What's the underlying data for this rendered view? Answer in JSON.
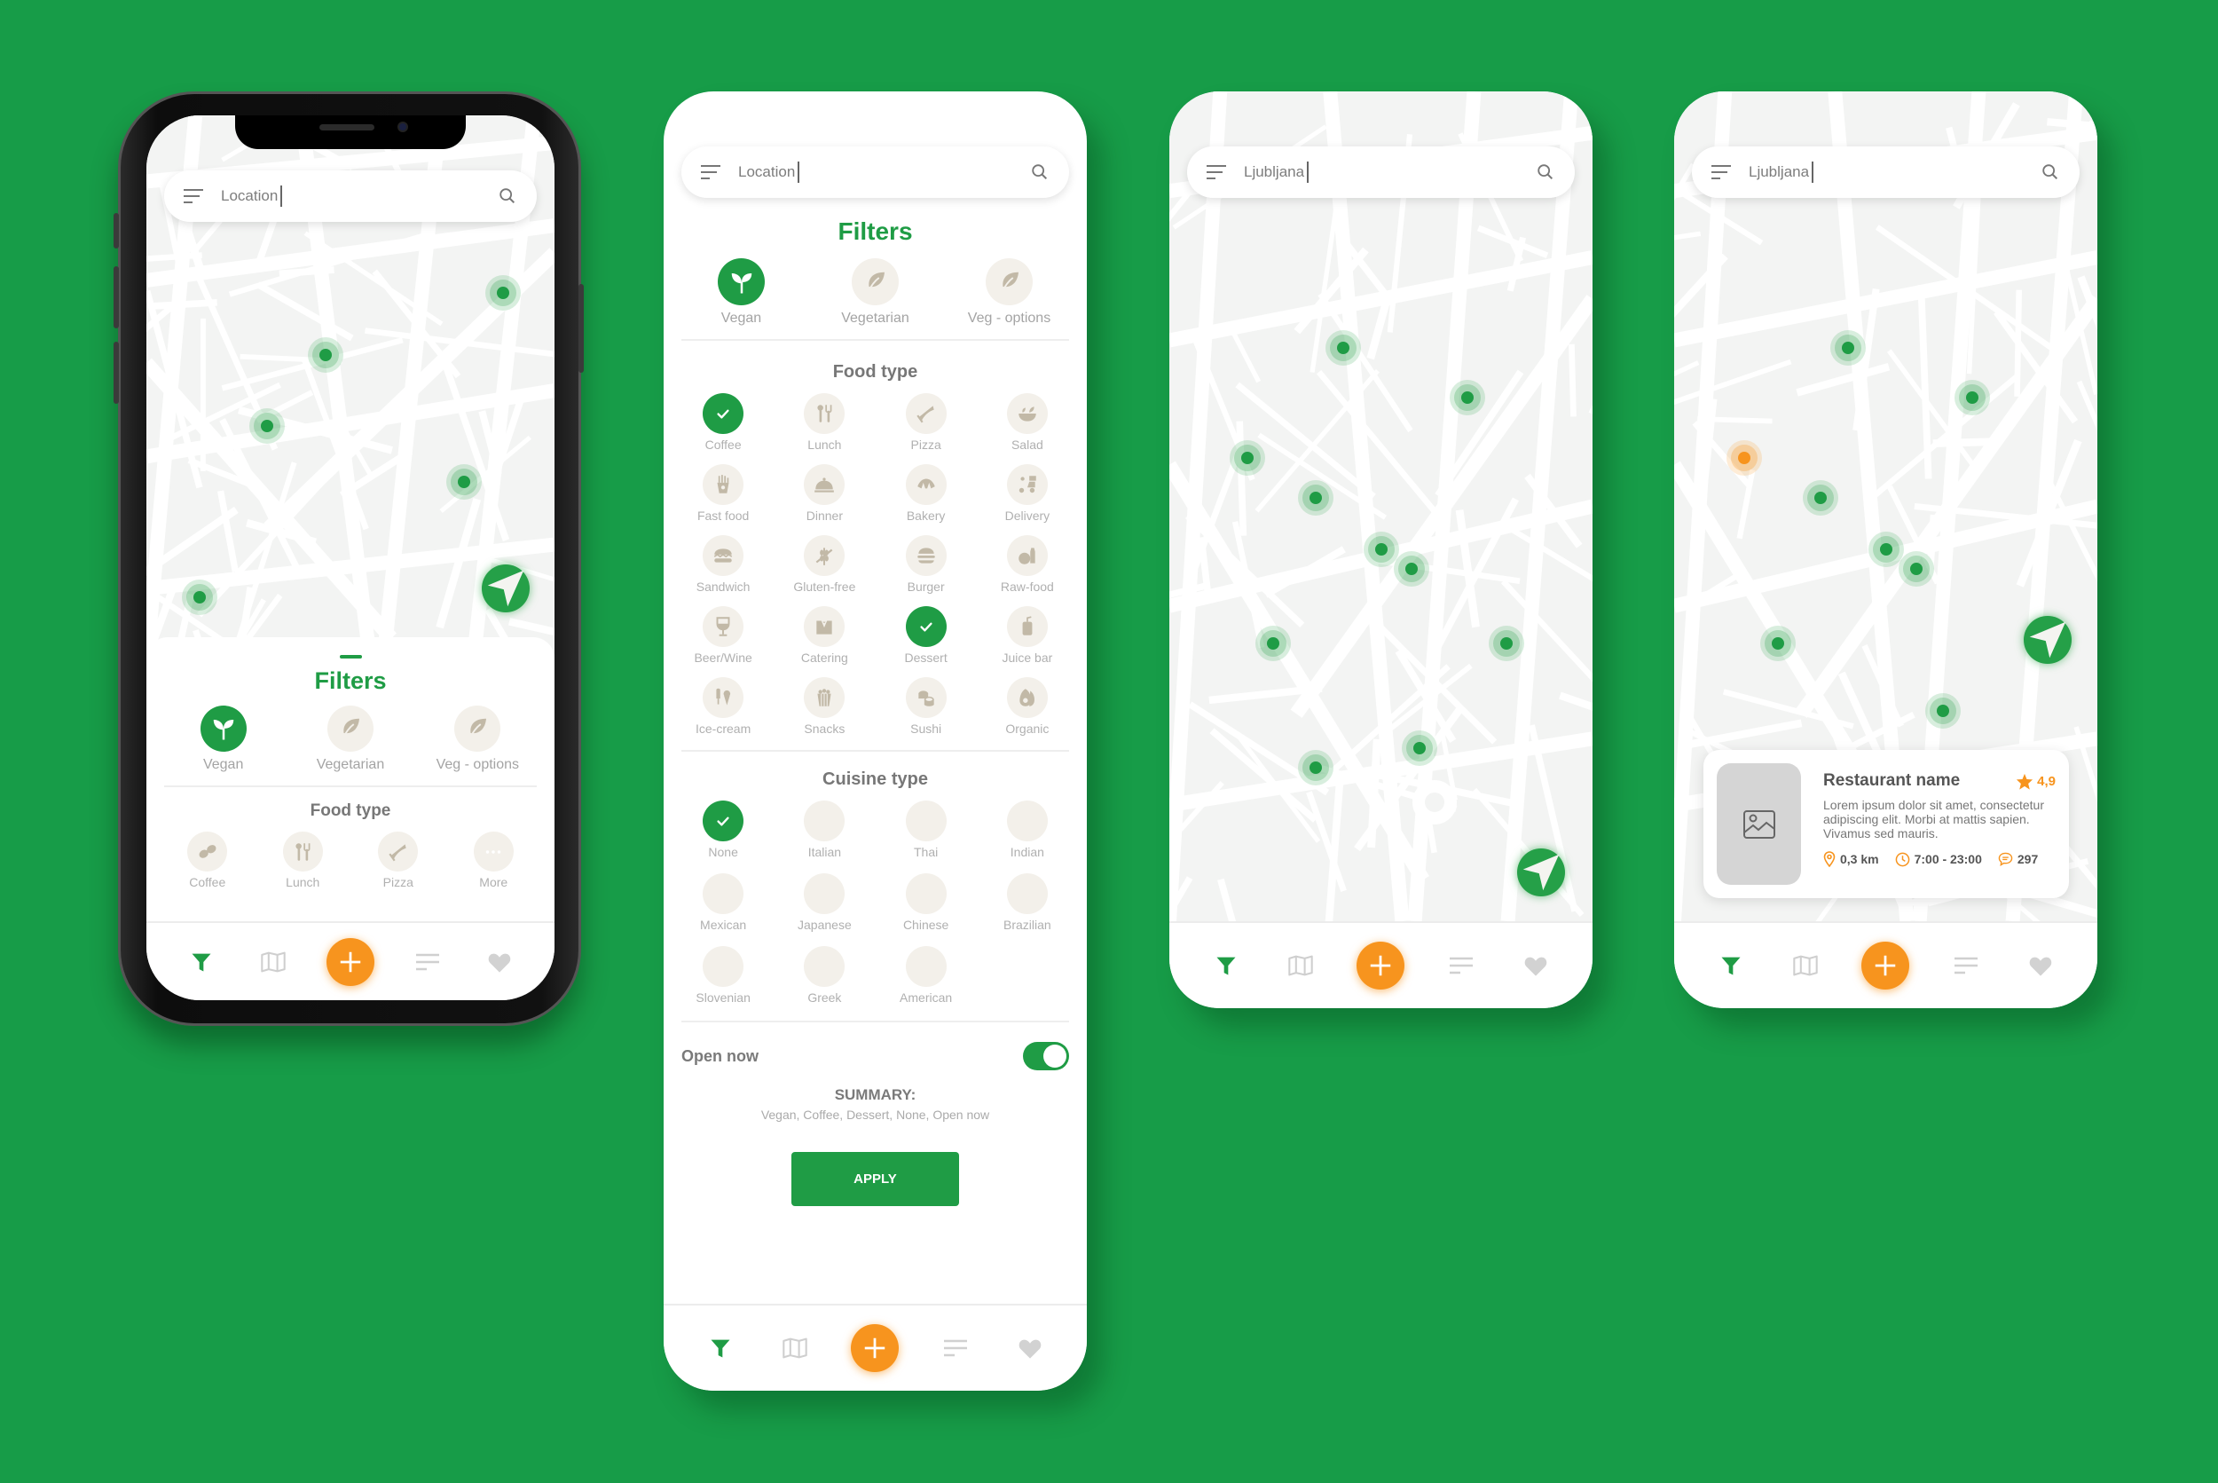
{
  "colors": {
    "background": "#179c48",
    "brand_green": "#1f9c45",
    "accent_orange": "#f7941e",
    "icon_beige": "#c2b9a7",
    "circle_beige": "#f3f0ea"
  },
  "screens": [
    {
      "id": "map-with-filter-sheet",
      "search": {
        "value": "Location",
        "menu_icon": "menu-icon",
        "search_icon": "search-icon"
      },
      "sheet": {
        "title": "Filters",
        "diet": [
          {
            "label": "Vegan",
            "icon": "sprout-icon",
            "selected": true
          },
          {
            "label": "Vegetarian",
            "icon": "leaf-icon",
            "selected": false
          },
          {
            "label": "Veg - options",
            "icon": "leaf-icon",
            "selected": false
          }
        ],
        "food_type_title": "Food type",
        "food_types": [
          {
            "label": "Coffee",
            "icon": "coffee-beans-icon"
          },
          {
            "label": "Lunch",
            "icon": "cutlery-icon"
          },
          {
            "label": "Pizza",
            "icon": "pizza-icon"
          },
          {
            "label": "More",
            "icon": "more-icon"
          }
        ]
      }
    },
    {
      "id": "filters-screen",
      "search": {
        "value": "Location"
      },
      "title": "Filters",
      "diet": [
        {
          "label": "Vegan",
          "icon": "sprout-icon",
          "selected": true
        },
        {
          "label": "Vegetarian",
          "icon": "leaf-icon",
          "selected": false
        },
        {
          "label": "Veg - options",
          "icon": "leaf-icon",
          "selected": false
        }
      ],
      "food_type_title": "Food type",
      "food_types": [
        {
          "label": "Coffee",
          "icon": "coffee-icon",
          "selected": true
        },
        {
          "label": "Lunch",
          "icon": "cutlery-icon",
          "selected": false
        },
        {
          "label": "Pizza",
          "icon": "pizza-icon",
          "selected": false
        },
        {
          "label": "Salad",
          "icon": "salad-icon",
          "selected": false
        },
        {
          "label": "Fast food",
          "icon": "fries-icon",
          "selected": false
        },
        {
          "label": "Dinner",
          "icon": "cloche-icon",
          "selected": false
        },
        {
          "label": "Bakery",
          "icon": "croissant-icon",
          "selected": false
        },
        {
          "label": "Delivery",
          "icon": "scooter-icon",
          "selected": false
        },
        {
          "label": "Sandwich",
          "icon": "sandwich-icon",
          "selected": false
        },
        {
          "label": "Gluten-free",
          "icon": "gluten-free-icon",
          "selected": false
        },
        {
          "label": "Burger",
          "icon": "burger-icon",
          "selected": false
        },
        {
          "label": "Raw-food",
          "icon": "raw-food-icon",
          "selected": false
        },
        {
          "label": "Beer/Wine",
          "icon": "wine-glass-icon",
          "selected": false
        },
        {
          "label": "Catering",
          "icon": "tuxedo-icon",
          "selected": false
        },
        {
          "label": "Dessert",
          "icon": "dessert-icon",
          "selected": true
        },
        {
          "label": "Juice bar",
          "icon": "juice-icon",
          "selected": false
        },
        {
          "label": "Ice-cream",
          "icon": "ice-cream-icon",
          "selected": false
        },
        {
          "label": "Snacks",
          "icon": "popcorn-icon",
          "selected": false
        },
        {
          "label": "Sushi",
          "icon": "sushi-icon",
          "selected": false
        },
        {
          "label": "Organic",
          "icon": "avocado-icon",
          "selected": false
        }
      ],
      "cuisine_title": "Cuisine type",
      "cuisines": [
        {
          "label": "None",
          "selected": true
        },
        {
          "label": "Italian",
          "selected": false
        },
        {
          "label": "Thai",
          "selected": false
        },
        {
          "label": "Indian",
          "selected": false
        },
        {
          "label": "Mexican",
          "selected": false
        },
        {
          "label": "Japanese",
          "selected": false
        },
        {
          "label": "Chinese",
          "selected": false
        },
        {
          "label": "Brazilian",
          "selected": false
        },
        {
          "label": "Slovenian",
          "selected": false
        },
        {
          "label": "Greek",
          "selected": false
        },
        {
          "label": "American",
          "selected": false
        }
      ],
      "open_now": {
        "label": "Open now",
        "on": true
      },
      "summary_title": "SUMMARY:",
      "summary_text": "Vegan, Coffee, Dessert, None, Open now",
      "apply_label": "APPLY"
    },
    {
      "id": "map-results",
      "search": {
        "value": "Ljubljana"
      }
    },
    {
      "id": "map-restaurant-card",
      "search": {
        "value": "Ljubljana"
      },
      "card": {
        "name": "Restaurant name",
        "rating": "4,9",
        "description": "Lorem ipsum dolor sit amet, consectetur adipiscing elit. Morbi at mattis sapien. Vivamus sed mauris.",
        "distance": "0,3 km",
        "hours": "7:00 - 23:00",
        "comments": "297"
      }
    }
  ],
  "bottom_nav": [
    {
      "name": "filter",
      "icon": "filter-icon",
      "active": true
    },
    {
      "name": "map",
      "icon": "map-icon",
      "active": false
    },
    {
      "name": "add",
      "icon": "plus-icon",
      "active": false
    },
    {
      "name": "list",
      "icon": "list-icon",
      "active": false
    },
    {
      "name": "favorites",
      "icon": "heart-icon",
      "active": false
    }
  ]
}
